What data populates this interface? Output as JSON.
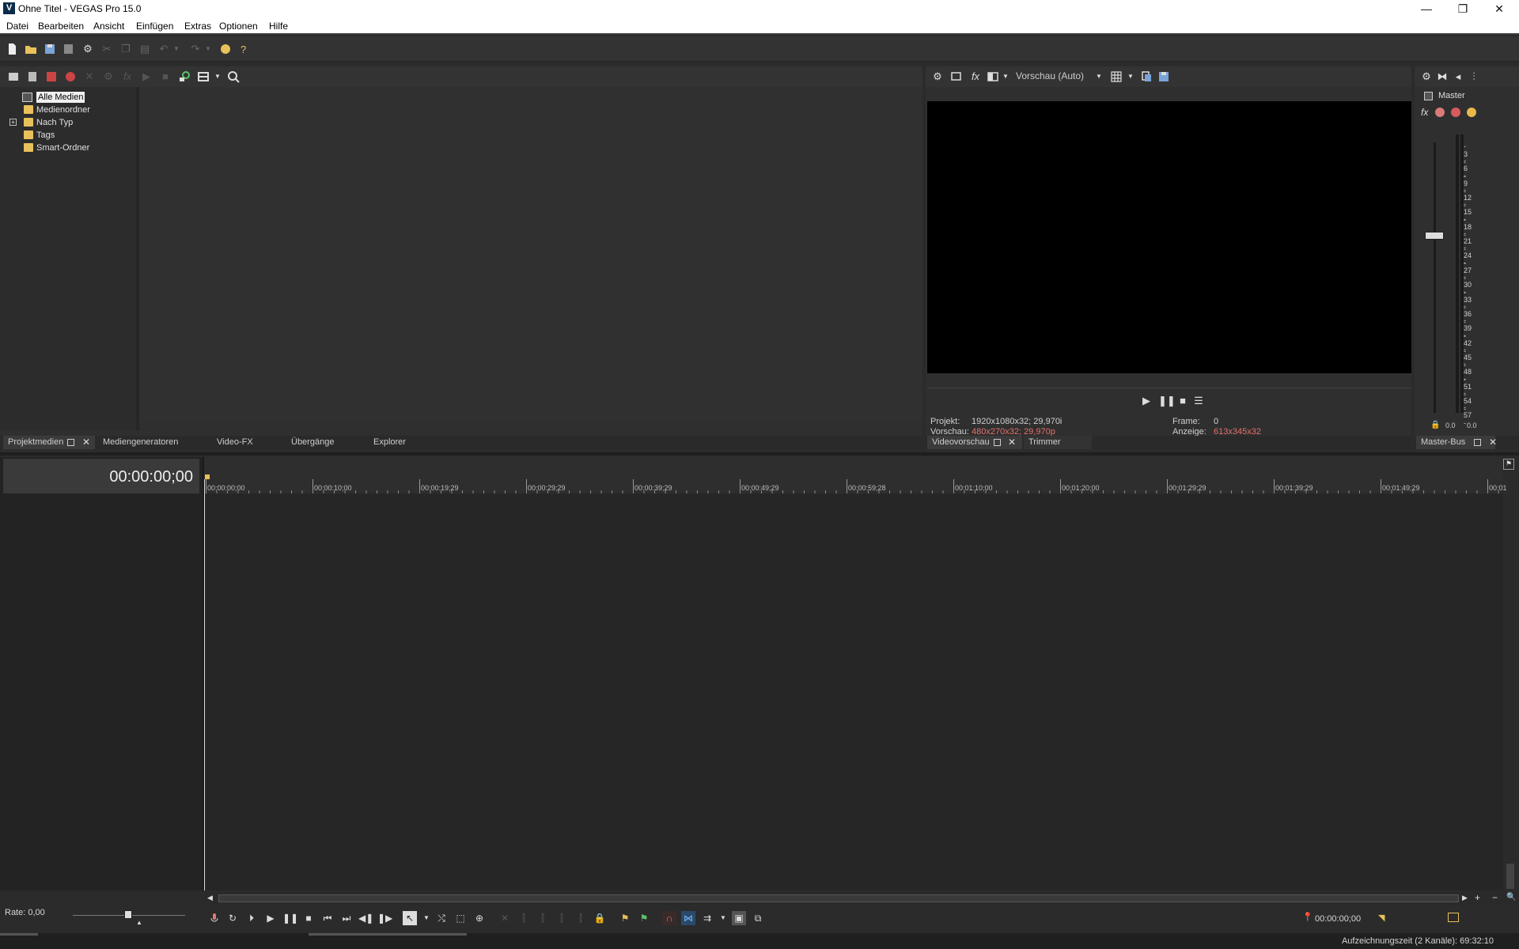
{
  "window": {
    "title": "Ohne Titel - VEGAS Pro 15.0",
    "app_icon_letter": "V",
    "minimize": "—",
    "maximize": "❐",
    "close": "✕"
  },
  "menu": [
    "Datei",
    "Bearbeiten",
    "Ansicht",
    "Einfügen",
    "Extras",
    "Optionen",
    "Hilfe"
  ],
  "media": {
    "tree": [
      "Alle Medien",
      "Medienordner",
      "Nach Typ",
      "Tags",
      "Smart-Ordner"
    ],
    "expander": "+",
    "tabs": [
      "Projektmedien",
      "Mediengeneratoren",
      "Video-FX",
      "Übergänge",
      "Explorer"
    ]
  },
  "preview": {
    "quality_dropdown": "Vorschau (Auto)",
    "fx_label": "fx",
    "info": {
      "projekt_label": "Projekt:",
      "projekt_value": "1920x1080x32; 29,970i",
      "vorschau_label": "Vorschau:",
      "vorschau_value": "480x270x32; 29,970p",
      "frame_label": "Frame:",
      "frame_value": "0",
      "anzeige_label": "Anzeige:",
      "anzeige_value": "613x345x32"
    },
    "tabs": [
      "Videovorschau",
      "Trimmer"
    ]
  },
  "master": {
    "label": "Master",
    "fx_label": "fx",
    "scale": [
      "3",
      "6",
      "9",
      "12",
      "15",
      "18",
      "21",
      "24",
      "27",
      "30",
      "33",
      "36",
      "39",
      "42",
      "45",
      "48",
      "51",
      "54",
      "57"
    ],
    "left_value": "0.0",
    "right_value": "0.0",
    "tab": "Master-Bus"
  },
  "timeline": {
    "timecode": "00:00:00;00",
    "ruler": [
      "00:00:00;00",
      "00:00:10;00",
      "00:00:19;29",
      "00:00:29;29",
      "00:00:39;29",
      "00:00:49;29",
      "00:00:59;28",
      "00:01:10;00",
      "00:01:20;00",
      "00:01:29;29",
      "00:01:39;29",
      "00:01:49;29",
      "00:01"
    ],
    "rate": "Rate: 0,00",
    "cursor_time": "00:00:00;00",
    "status": "Aufzeichnungszeit (2 Kanäle): 69:32:10"
  },
  "colors": {
    "accent_red": "#e4706c",
    "folder": "#e8c15a",
    "background": "#2b2b2b"
  }
}
